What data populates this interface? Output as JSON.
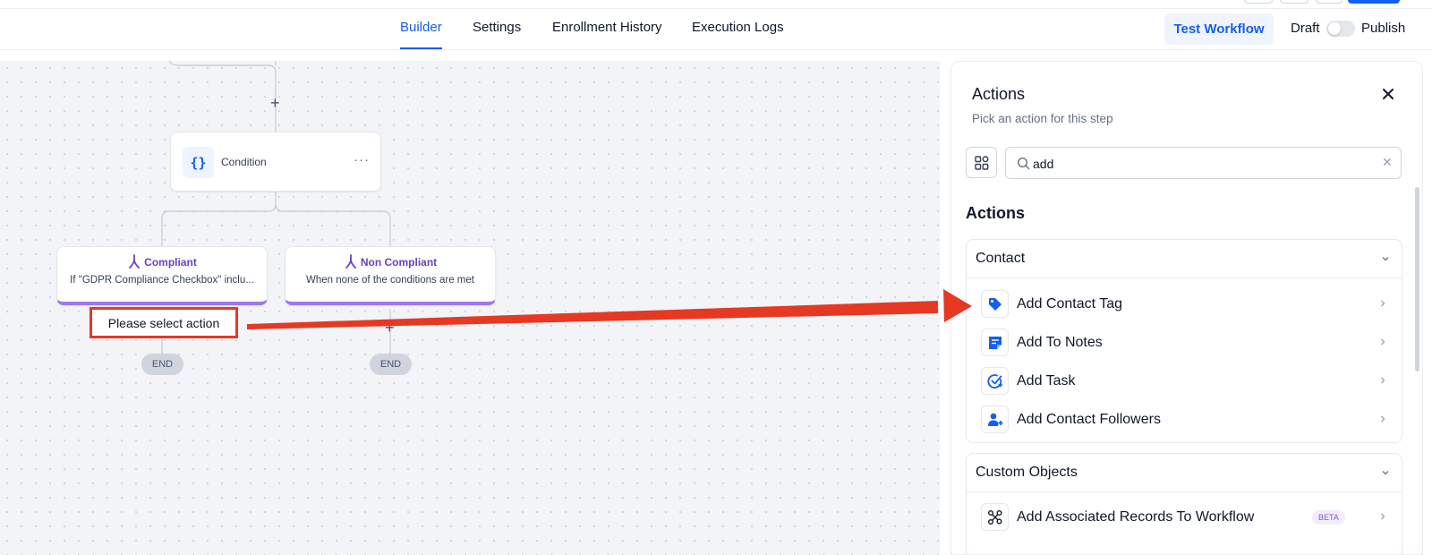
{
  "nav": {
    "tabs": [
      "Builder",
      "Settings",
      "Enrollment History",
      "Execution Logs"
    ],
    "active_tab": "Builder",
    "test_button": "Test Workflow",
    "draft_label": "Draft",
    "publish_label": "Publish",
    "publish_toggle_on": false
  },
  "canvas": {
    "condition_node": {
      "icon": "{}",
      "label": "Condition",
      "menu": "···"
    },
    "branches": [
      {
        "name": "Compliant",
        "description": "If \"GDPR Compliance Checkbox\" inclu..."
      },
      {
        "name": "Non Compliant",
        "description": "When none of the conditions are met"
      }
    ],
    "placeholder_action": "Please select action",
    "plus_symbol": "+",
    "end_label": "END"
  },
  "panel": {
    "title": "Actions",
    "subtitle": "Pick an action for this step",
    "search_value": "add",
    "section_title": "Actions",
    "groups": [
      {
        "name": "Contact",
        "items": [
          {
            "label": "Add Contact Tag",
            "icon": "tag-icon"
          },
          {
            "label": "Add To Notes",
            "icon": "note-icon"
          },
          {
            "label": "Add Task",
            "icon": "task-check-icon"
          },
          {
            "label": "Add Contact Followers",
            "icon": "user-add-icon"
          }
        ]
      },
      {
        "name": "Custom Objects",
        "items": [
          {
            "label": "Add Associated Records To Workflow",
            "icon": "associate-nodes-icon",
            "badge": "BETA"
          }
        ]
      }
    ]
  },
  "colors": {
    "accent": "#155eef",
    "branch_purple": "#6941c6",
    "highlight_red": "#e53924"
  }
}
